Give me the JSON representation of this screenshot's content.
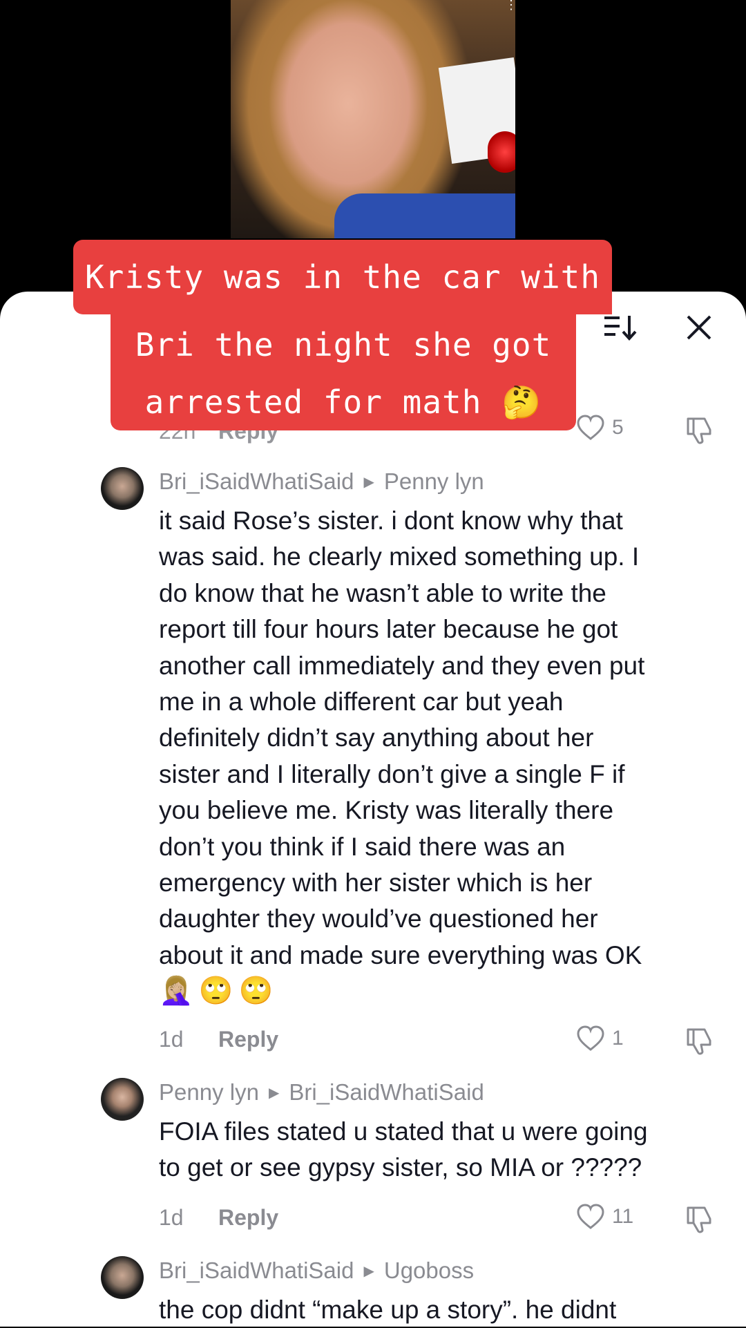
{
  "video": {
    "caption_lines": [
      "Kristy was in the car with",
      "Bri the night she got",
      "arrested for math 🤔"
    ]
  },
  "sheet": {
    "top_partial": {
      "time": "22h",
      "reply": "Reply",
      "likes": "5"
    }
  },
  "comments": [
    {
      "author": "Bri_iSaidWhatiSaid",
      "reply_to": "Penny lyn",
      "text_lines": [
        "it said Rose’s sister. i dont know why that",
        "was said. he clearly mixed something up. I",
        "do know that he wasn’t able to write the",
        "report till four hours later because he got",
        "another call immediately and they even put",
        "me in a whole different car but yeah",
        "definitely didn’t say anything about her",
        "sister and I literally don’t give a single F if",
        "you believe me. Kristy was literally there",
        "don’t you think if I said there was an",
        "emergency with her sister which is her",
        "daughter they would’ve questioned her",
        "about it and made sure everything was OK"
      ],
      "emojis": [
        "🤦🏼‍♀️",
        "🙄",
        "🙄"
      ],
      "time": "1d",
      "reply": "Reply",
      "likes": "1"
    },
    {
      "author": "Penny lyn",
      "reply_to": "Bri_iSaidWhatiSaid",
      "text_lines": [
        "FOIA files stated u stated that u were going",
        "to get or see gypsy sister, so MIA or ?????"
      ],
      "time": "1d",
      "reply": "Reply",
      "likes": "11"
    },
    {
      "author": "Bri_iSaidWhatiSaid",
      "reply_to": "Ugoboss",
      "text_lines": [
        "the cop didnt “make up a story”. he didnt"
      ]
    }
  ],
  "icons": {
    "sort": "sort-icon",
    "close": "close-icon",
    "like": "heart-outline-icon",
    "dislike": "thumbs-down-icon"
  },
  "colors": {
    "caption_bg": "#e8403f",
    "meta_gray": "#8a8b91",
    "text": "#161823"
  }
}
